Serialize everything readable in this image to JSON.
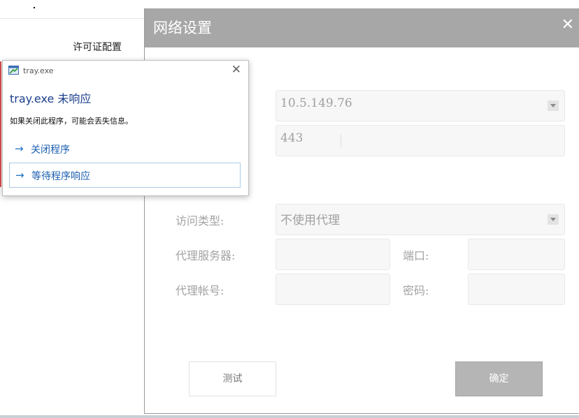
{
  "background": {
    "license_config": "许可证配置"
  },
  "dialog": {
    "title": "网络设置",
    "close_symbol": "✕",
    "server_address": "10.5.149.76",
    "port_value": "443",
    "access_type_label": "访问类型:",
    "access_type_value": "不使用代理",
    "proxy_server_label": "代理服务器:",
    "proxy_port_label": "端口:",
    "proxy_account_label": "代理帐号:",
    "password_label": "密码:",
    "test_button": "测试",
    "ok_button": "确定"
  },
  "popup": {
    "app_name": "tray.exe",
    "close_symbol": "✕",
    "heading": "tray.exe 未响应",
    "message": "如果关闭此程序，可能会丢失信息。",
    "arrow_symbol": "→",
    "options": [
      {
        "label": "关闭程序"
      },
      {
        "label": "等待程序响应"
      }
    ]
  },
  "colors": {
    "dialog_header": "#a7a7a7",
    "link_blue": "#1b72c6",
    "heading_blue": "#1a3e8c",
    "ok_button": "#b5b5b5"
  }
}
